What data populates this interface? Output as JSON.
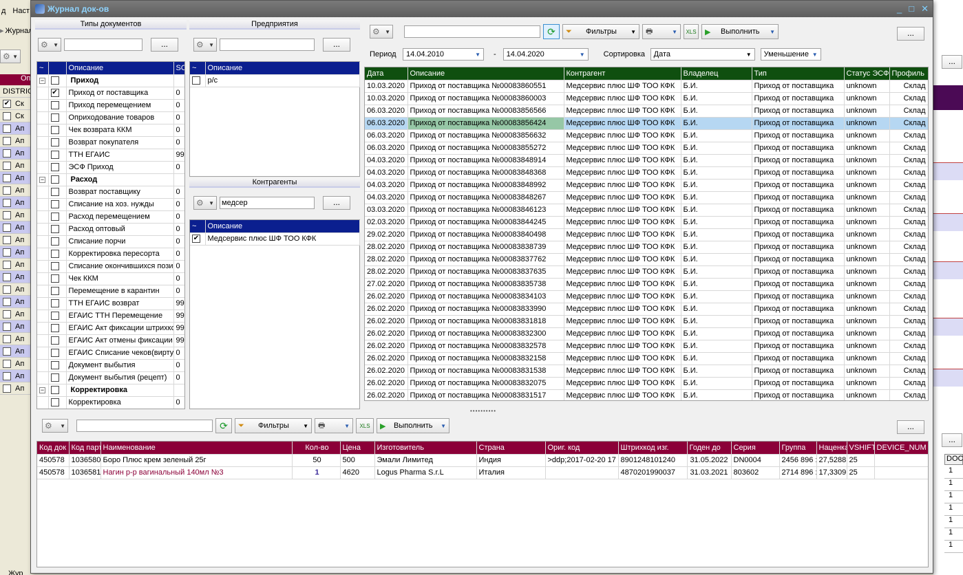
{
  "background": {
    "menu": [
      "д",
      "Наст"
    ],
    "tab_label": "Журнал",
    "side_header": "Оп",
    "side_rows": [
      "DISTRIC",
      "Ск",
      "Ск",
      "Ап",
      "Ап",
      "Ап",
      "Ап",
      "Ап",
      "Ап",
      "Ап",
      "Ап",
      "Ап",
      "Ап",
      "Ап",
      "Ап",
      "Ап",
      "Ап",
      "Ап",
      "Ап",
      "Ап",
      "Ап",
      "Ап",
      "Ап",
      "Ап",
      "Ап"
    ],
    "right_doc_header": "DOC",
    "right_doc_values": [
      "1",
      "1",
      "1",
      "1",
      "1",
      "1",
      "1"
    ],
    "right_buttons": [
      "...",
      "...",
      "..."
    ],
    "bottom_tab": "Жур"
  },
  "window": {
    "title": "Журнал док-ов",
    "controls": [
      "_",
      "□",
      "✕"
    ]
  },
  "doc_types": {
    "title": "Типы документов",
    "search_value": "",
    "dots_label": "...",
    "col_tilde": "~",
    "col_desc": "Описание",
    "col_so": "SO",
    "groups": [
      {
        "name": "Приход",
        "items": [
          {
            "label": "Приход от поставщика",
            "checked": true,
            "so": "0"
          },
          {
            "label": "Приход перемещением",
            "checked": false,
            "so": "0"
          },
          {
            "label": "Оприходование товаров",
            "checked": false,
            "so": "0"
          },
          {
            "label": "Чек возврата ККМ",
            "checked": false,
            "so": "0"
          },
          {
            "label": "Возврат покупателя",
            "checked": false,
            "so": "0"
          },
          {
            "label": "ТТН ЕГАИС",
            "checked": false,
            "so": "99"
          },
          {
            "label": "ЭСФ Приход",
            "checked": false,
            "so": "0"
          }
        ]
      },
      {
        "name": "Расход",
        "items": [
          {
            "label": "Возврат поставщику",
            "checked": false,
            "so": "0"
          },
          {
            "label": "Списание на хоз. нужды",
            "checked": false,
            "so": "0"
          },
          {
            "label": "Расход перемещением",
            "checked": false,
            "so": "0"
          },
          {
            "label": "Расход оптовый",
            "checked": false,
            "so": "0"
          },
          {
            "label": "Списание порчи",
            "checked": false,
            "so": "0"
          },
          {
            "label": "Корректировка пересорта",
            "checked": false,
            "so": "0"
          },
          {
            "label": "Списание окончившихся пози",
            "checked": false,
            "so": "0"
          },
          {
            "label": "Чек ККМ",
            "checked": false,
            "so": "0"
          },
          {
            "label": "Перемещение в карантин",
            "checked": false,
            "so": "0"
          },
          {
            "label": "ТТН ЕГАИС возврат",
            "checked": false,
            "so": "99"
          },
          {
            "label": "ЕГАИС ТТН Перемещение",
            "checked": false,
            "so": "99"
          },
          {
            "label": "ЕГАИС Акт фиксации штрихкс",
            "checked": false,
            "so": "99"
          },
          {
            "label": "ЕГАИС Акт отмены фиксации",
            "checked": false,
            "so": "99"
          },
          {
            "label": "ЕГАИС Списание чеков(вирту",
            "checked": false,
            "so": "0"
          },
          {
            "label": "Документ выбытия",
            "checked": false,
            "so": "0"
          },
          {
            "label": "Документ выбытия (рецепт)",
            "checked": false,
            "so": "0"
          }
        ]
      },
      {
        "name": "Корректировка",
        "items": [
          {
            "label": "Корректировка",
            "checked": false,
            "so": "0"
          }
        ]
      }
    ]
  },
  "enterprises": {
    "title": "Предприятия",
    "search_value": "",
    "dots_label": "...",
    "col_tilde": "~",
    "col_desc": "Описание",
    "rows": [
      {
        "label": "р/с",
        "checked": false
      }
    ]
  },
  "counterparties": {
    "title": "Контрагенты",
    "search_value": "медсер",
    "dots_label": "...",
    "col_tilde": "~",
    "col_desc": "Описание",
    "rows": [
      {
        "label": "Медсервис плюс ШФ ТОО КФК",
        "checked": true
      }
    ]
  },
  "documents": {
    "toolbar": {
      "search_value": "",
      "filters_label": "Фильтры",
      "execute_label": "Выполнить",
      "dots_label": "..."
    },
    "period_label": "Период",
    "date_from": "14.04.2010",
    "date_sep": "-",
    "date_to": "14.04.2020",
    "sort_label": "Сортировка",
    "sort_value": "Дата",
    "order_value": "Уменьшение",
    "columns": [
      "Дата",
      "Описание",
      "Контрагент",
      "Владелец",
      "Тип",
      "Статус ЭСФ",
      "Профиль"
    ],
    "selected_index": 3,
    "rows": [
      [
        "10.03.2020",
        "Приход от поставщика №00083860551",
        "Медсервис плюс ШФ ТОО КФК",
        "Б.И.",
        "Приход от поставщика",
        "unknown",
        "Склад"
      ],
      [
        "10.03.2020",
        "Приход от поставщика №00083860003",
        "Медсервис плюс ШФ ТОО КФК",
        "Б.И.",
        "Приход от поставщика",
        "unknown",
        "Склад"
      ],
      [
        "06.03.2020",
        "Приход от поставщика №00083856566",
        "Медсервис плюс ШФ ТОО КФК",
        "Б.И.",
        "Приход от поставщика",
        "unknown",
        "Склад"
      ],
      [
        "06.03.2020",
        "Приход от поставщика №00083856424",
        "Медсервис плюс ШФ ТОО КФК",
        "Б.И.",
        "Приход от поставщика",
        "unknown",
        "Склад"
      ],
      [
        "06.03.2020",
        "Приход от поставщика №00083856632",
        "Медсервис плюс ШФ ТОО КФК",
        "Б.И.",
        "Приход от поставщика",
        "unknown",
        "Склад"
      ],
      [
        "06.03.2020",
        "Приход от поставщика №00083855272",
        "Медсервис плюс ШФ ТОО КФК",
        "Б.И.",
        "Приход от поставщика",
        "unknown",
        "Склад"
      ],
      [
        "04.03.2020",
        "Приход от поставщика №00083848914",
        "Медсервис плюс ШФ ТОО КФК",
        "Б.И.",
        "Приход от поставщика",
        "unknown",
        "Склад"
      ],
      [
        "04.03.2020",
        "Приход от поставщика №00083848368",
        "Медсервис плюс ШФ ТОО КФК",
        "Б.И.",
        "Приход от поставщика",
        "unknown",
        "Склад"
      ],
      [
        "04.03.2020",
        "Приход от поставщика №00083848992",
        "Медсервис плюс ШФ ТОО КФК",
        "Б.И.",
        "Приход от поставщика",
        "unknown",
        "Склад"
      ],
      [
        "04.03.2020",
        "Приход от поставщика №00083848267",
        "Медсервис плюс ШФ ТОО КФК",
        "Б.И.",
        "Приход от поставщика",
        "unknown",
        "Склад"
      ],
      [
        "03.03.2020",
        "Приход от поставщика №00083846123",
        "Медсервис плюс ШФ ТОО КФК",
        "Б.И.",
        "Приход от поставщика",
        "unknown",
        "Склад"
      ],
      [
        "02.03.2020",
        "Приход от поставщика №00083844245",
        "Медсервис плюс ШФ ТОО КФК",
        "Б.И.",
        "Приход от поставщика",
        "unknown",
        "Склад"
      ],
      [
        "29.02.2020",
        "Приход от поставщика №00083840498",
        "Медсервис плюс ШФ ТОО КФК",
        "Б.И.",
        "Приход от поставщика",
        "unknown",
        "Склад"
      ],
      [
        "28.02.2020",
        "Приход от поставщика №00083838739",
        "Медсервис плюс ШФ ТОО КФК",
        "Б.И.",
        "Приход от поставщика",
        "unknown",
        "Склад"
      ],
      [
        "28.02.2020",
        "Приход от поставщика №00083837762",
        "Медсервис плюс ШФ ТОО КФК",
        "Б.И.",
        "Приход от поставщика",
        "unknown",
        "Склад"
      ],
      [
        "28.02.2020",
        "Приход от поставщика №00083837635",
        "Медсервис плюс ШФ ТОО КФК",
        "Б.И.",
        "Приход от поставщика",
        "unknown",
        "Склад"
      ],
      [
        "27.02.2020",
        "Приход от поставщика №00083835738",
        "Медсервис плюс ШФ ТОО КФК",
        "Б.И.",
        "Приход от поставщика",
        "unknown",
        "Склад"
      ],
      [
        "26.02.2020",
        "Приход от поставщика №00083834103",
        "Медсервис плюс ШФ ТОО КФК",
        "Б.И.",
        "Приход от поставщика",
        "unknown",
        "Склад"
      ],
      [
        "26.02.2020",
        "Приход от поставщика №00083833990",
        "Медсервис плюс ШФ ТОО КФК",
        "Б.И.",
        "Приход от поставщика",
        "unknown",
        "Склад"
      ],
      [
        "26.02.2020",
        "Приход от поставщика №00083831818",
        "Медсервис плюс ШФ ТОО КФК",
        "Б.И.",
        "Приход от поставщика",
        "unknown",
        "Склад"
      ],
      [
        "26.02.2020",
        "Приход от поставщика №00083832300",
        "Медсервис плюс ШФ ТОО КФК",
        "Б.И.",
        "Приход от поставщика",
        "unknown",
        "Склад"
      ],
      [
        "26.02.2020",
        "Приход от поставщика №00083832578",
        "Медсервис плюс ШФ ТОО КФК",
        "Б.И.",
        "Приход от поставщика",
        "unknown",
        "Склад"
      ],
      [
        "26.02.2020",
        "Приход от поставщика №00083832158",
        "Медсервис плюс ШФ ТОО КФК",
        "Б.И.",
        "Приход от поставщика",
        "unknown",
        "Склад"
      ],
      [
        "26.02.2020",
        "Приход от поставщика №00083831538",
        "Медсервис плюс ШФ ТОО КФК",
        "Б.И.",
        "Приход от поставщика",
        "unknown",
        "Склад"
      ],
      [
        "26.02.2020",
        "Приход от поставщика №00083832075",
        "Медсервис плюс ШФ ТОО КФК",
        "Б.И.",
        "Приход от поставщика",
        "unknown",
        "Склад"
      ],
      [
        "26.02.2020",
        "Приход от поставщика №00083831517",
        "Медсервис плюс ШФ ТОО КФК",
        "Б.И.",
        "Приход от поставщика",
        "unknown",
        "Склад"
      ]
    ]
  },
  "details": {
    "toolbar": {
      "search_value": "",
      "filters_label": "Фильтры",
      "execute_label": "Выполнить",
      "dots_label": "..."
    },
    "columns": [
      "Код док",
      "Код парт",
      "Наименование",
      "Кол-во",
      "Цена",
      "Изготовитель",
      "Страна",
      "Ориг. код",
      "Штрихкод изг.",
      "Годен до",
      "Серия",
      "Группа",
      "Наценка",
      "VSHIFT",
      "DEVICE_NUM"
    ],
    "rows": [
      [
        "450578",
        "1036580",
        "Боро Плюс крем зеленый 25г",
        "50",
        "500",
        "Эмали Лимитед",
        "Индия",
        ">ddp;2017-02-20 17",
        "8901248101240",
        "31.05.2022",
        "DN0004",
        "2456  896  :",
        "27,5288",
        "25",
        ""
      ],
      [
        "450578",
        "1036581",
        "Нагин р-р вагинальный 140мл №3",
        "1",
        "4620",
        "Logus Pharma S.r.L",
        "Италия",
        "",
        "4870201990037",
        "31.03.2021",
        "803602",
        "2714  896  :",
        "17,3309",
        "25",
        ""
      ]
    ]
  },
  "colors": {
    "types_header": "#0b1f8f",
    "docs_header": "#0f4f0f",
    "details_header": "#8b0038",
    "selected_row": "#b6d7f2"
  }
}
